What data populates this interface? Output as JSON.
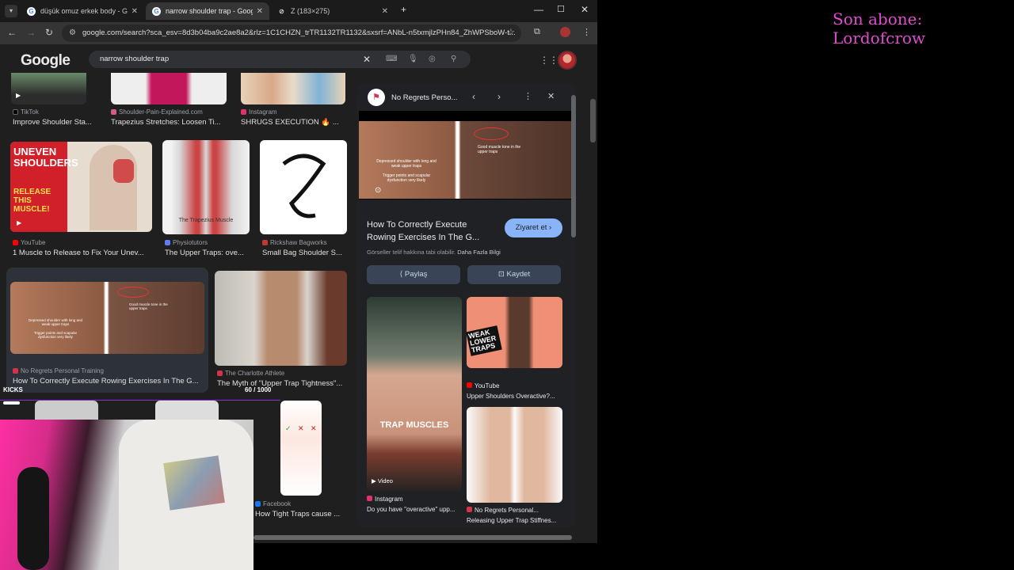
{
  "browser": {
    "tabs": [
      {
        "title": "düşük omuz erkek body - Goog",
        "active": false
      },
      {
        "title": "narrow shoulder trap - Google",
        "active": true
      },
      {
        "title": "Z (183×275)",
        "active": false
      }
    ],
    "new_tab": "+",
    "url": "google.com/search?sca_esv=8d3b04ba9c2ae8a2&rlz=1C1CHZN_trTR1132TR1132&sxsrf=ANbL-n5txmjlzPHn84_ZhWPSboW-t..."
  },
  "google": {
    "logo": "Google",
    "query": "narrow shoulder trap"
  },
  "results": [
    {
      "source": "TikTok",
      "title": "Improve Shoulder Sta...",
      "fav_color": "#000000"
    },
    {
      "source": "Shoulder-Pain-Explained.com",
      "title": "Trapezius Stretches: Loosen Ti...",
      "fav_color": "#d15a88"
    },
    {
      "source": "Instagram",
      "title": "SHRUGS EXECUTION 🔥 ...",
      "fav_color": "#e1306c"
    },
    {
      "source": "YouTube",
      "title": "1 Muscle to Release to Fix Your Unev...",
      "fav_color": "#ff0000"
    },
    {
      "source": "Physiotutors",
      "title": "The Upper Traps: ove...",
      "fav_color": "#5c7cfa"
    },
    {
      "source": "Rickshaw Bagworks",
      "title": "Small Bag Shoulder S...",
      "fav_color": "#c0392b"
    },
    {
      "source": "No Regrets Personal Training",
      "title": "How To Correctly Execute Rowing Exercises In The G...",
      "fav_color": "#d1334a"
    },
    {
      "source": "The Charlotte Athlete",
      "title": "The Myth of \"Upper Trap Tightness\"...",
      "fav_color": "#d1334a"
    },
    {
      "source": "Facebook",
      "title": "How Tight Traps cause ...",
      "fav_color": "#1877f2"
    }
  ],
  "thumb_text": {
    "uneven": "UNEVEN SHOULDERS",
    "release": "RELEASE THIS MUSCLE!",
    "trapezius": "The Trapezius Muscle",
    "depressed": "Depressed shoulder with long and weak upper traps",
    "trigger": "Trigger points and scapular dysfunction very likely",
    "good": "Good muscle tone in the upper traps"
  },
  "panel": {
    "source": "No Regrets Perso...",
    "title": "How To Correctly Execute Rowing Exercises In The G...",
    "visit": "Ziyaret et",
    "notice": "Görseller telif hakkına tabi olabilir.",
    "more_info": "Daha Fazla Bilgi",
    "share": "Paylaş",
    "save": "Kaydet",
    "related": [
      {
        "source": "Instagram",
        "title": "Do you have \"overactive\" upp...",
        "badge": "Video",
        "overlay": "TRAP MUSCLES"
      },
      {
        "source": "YouTube",
        "title": "Upper Shoulders Overactive?...",
        "overlay": "WEAK LOWER TRAPS"
      },
      {
        "source": "No Regrets Personal...",
        "title": "Releasing Upper Trap Stiffnes..."
      }
    ]
  },
  "stream": {
    "last_sub": "Son abone: Lordofcrow",
    "goal_label": "KICKS",
    "goal_value": "60 / 1000",
    "goal_progress": 0.06
  }
}
